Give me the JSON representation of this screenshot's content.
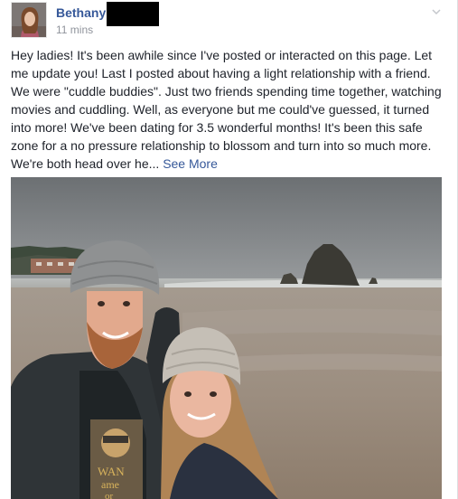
{
  "post": {
    "author": "Bethany",
    "timestamp": "11 mins",
    "body": "Hey ladies! It's been awhile since I've posted or interacted on this page. Let me update you! Last I posted about having a light relationship with a friend. We were \"cuddle buddies\". Just two friends spending time together, watching movies and cuddling. Well, as everyone but me could've guessed, it turned into more! We've been dating for 3.5 wonderful months! It's been this safe zone for a no pressure relationship to blossom and turn into so much more. We're both head over he...",
    "see_more": "See More",
    "options_icon": "chevron-down-icon",
    "photo_shirt_text": [
      "WAN",
      "ame",
      "or"
    ]
  },
  "colors": {
    "link": "#365899",
    "text": "#1d2129",
    "meta": "#90949c"
  }
}
